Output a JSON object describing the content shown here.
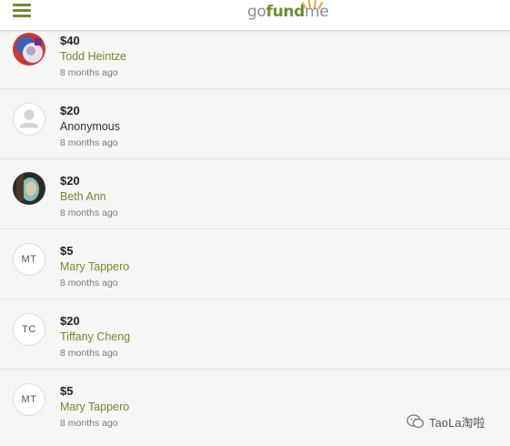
{
  "header": {
    "logo": {
      "go": "go",
      "fund": "fund",
      "me": "me"
    },
    "menu_icon": "hamburger-menu-icon"
  },
  "donations": [
    {
      "amount": "$40",
      "name": "Todd Heintze",
      "time": "8 months ago",
      "avatar": "photo",
      "name_linked": true
    },
    {
      "amount": "$20",
      "name": "Anonymous",
      "time": "8 months ago",
      "avatar": "anonymous",
      "name_linked": false
    },
    {
      "amount": "$20",
      "name": "Beth Ann",
      "time": "8 months ago",
      "avatar": "photo",
      "name_linked": true
    },
    {
      "amount": "$5",
      "name": "Mary Tappero",
      "time": "8 months ago",
      "avatar": "initials",
      "initials": "MT",
      "name_linked": true
    },
    {
      "amount": "$20",
      "name": "Tiffany Cheng",
      "time": "8 months ago",
      "avatar": "initials",
      "initials": "TC",
      "name_linked": true
    },
    {
      "amount": "$5",
      "name": "Mary Tappero",
      "time": "8 months ago",
      "avatar": "initials",
      "initials": "MT",
      "name_linked": true
    }
  ],
  "watermark": {
    "text": "TaoLa淘啦",
    "icon": "wechat-icon"
  },
  "colors": {
    "brand_green": "#6e8c33",
    "grey_text": "#7a7a7a",
    "background": "#f6f6f4"
  }
}
